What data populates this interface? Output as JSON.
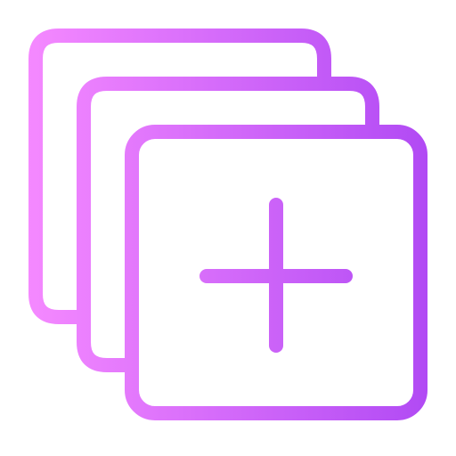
{
  "icon": {
    "name": "add-layers-icon",
    "gradient_start": "#f589ff",
    "gradient_end": "#b14af4",
    "background": "#ffffff"
  }
}
